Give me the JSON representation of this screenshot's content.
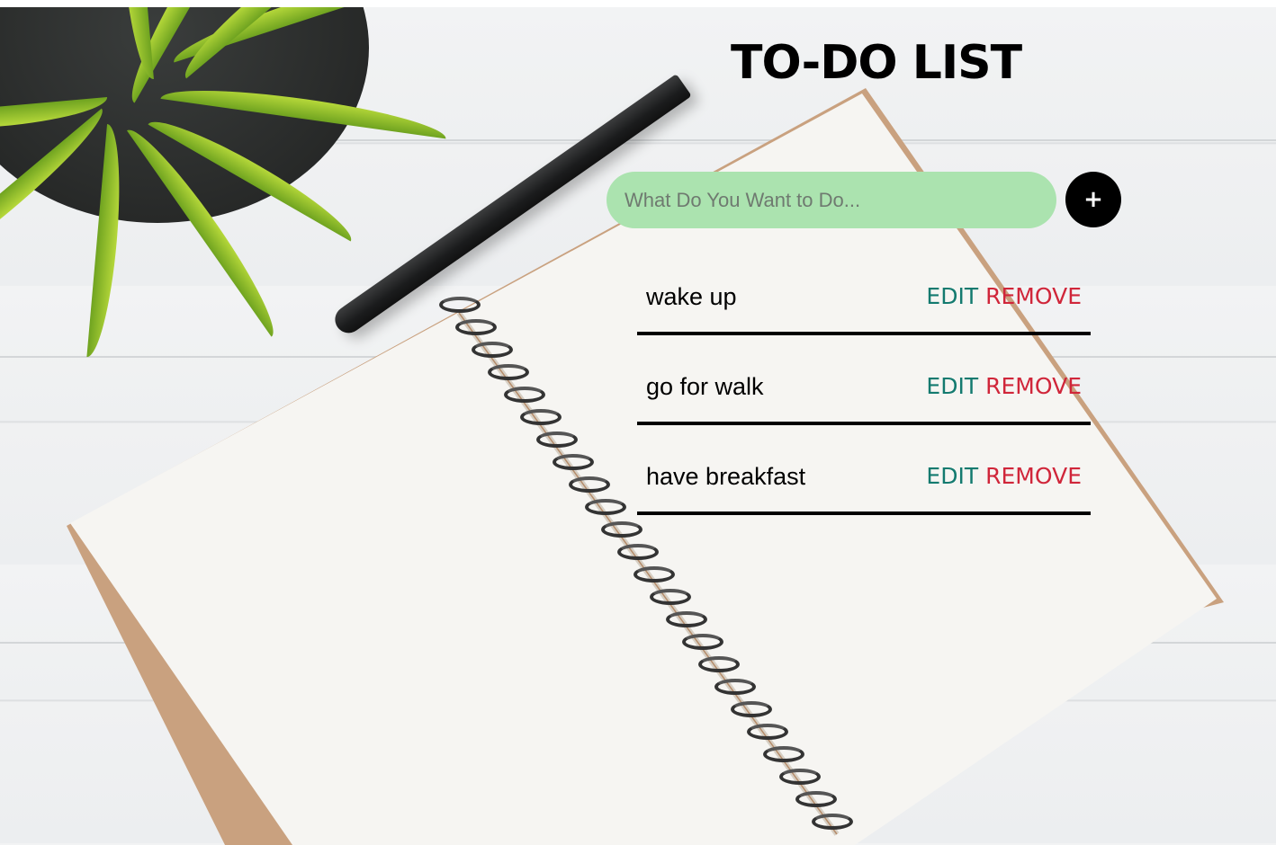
{
  "app": {
    "title": "TO-DO LIST"
  },
  "input": {
    "placeholder": "What Do You Want to Do...",
    "value": ""
  },
  "add_button": {
    "label": "+"
  },
  "tasks": [
    {
      "text": "wake up",
      "edit_label": "EDIT",
      "remove_label": "REMOVE"
    },
    {
      "text": "go for walk",
      "edit_label": "EDIT",
      "remove_label": "REMOVE"
    },
    {
      "text": "have breakfast",
      "edit_label": "EDIT",
      "remove_label": "REMOVE"
    }
  ],
  "colors": {
    "input_background": "#abe3af",
    "add_button_background": "#000000",
    "edit_color": "#137a6f",
    "remove_color": "#d0263a",
    "divider": "#000000"
  },
  "icons": {
    "add": "plus-icon"
  }
}
